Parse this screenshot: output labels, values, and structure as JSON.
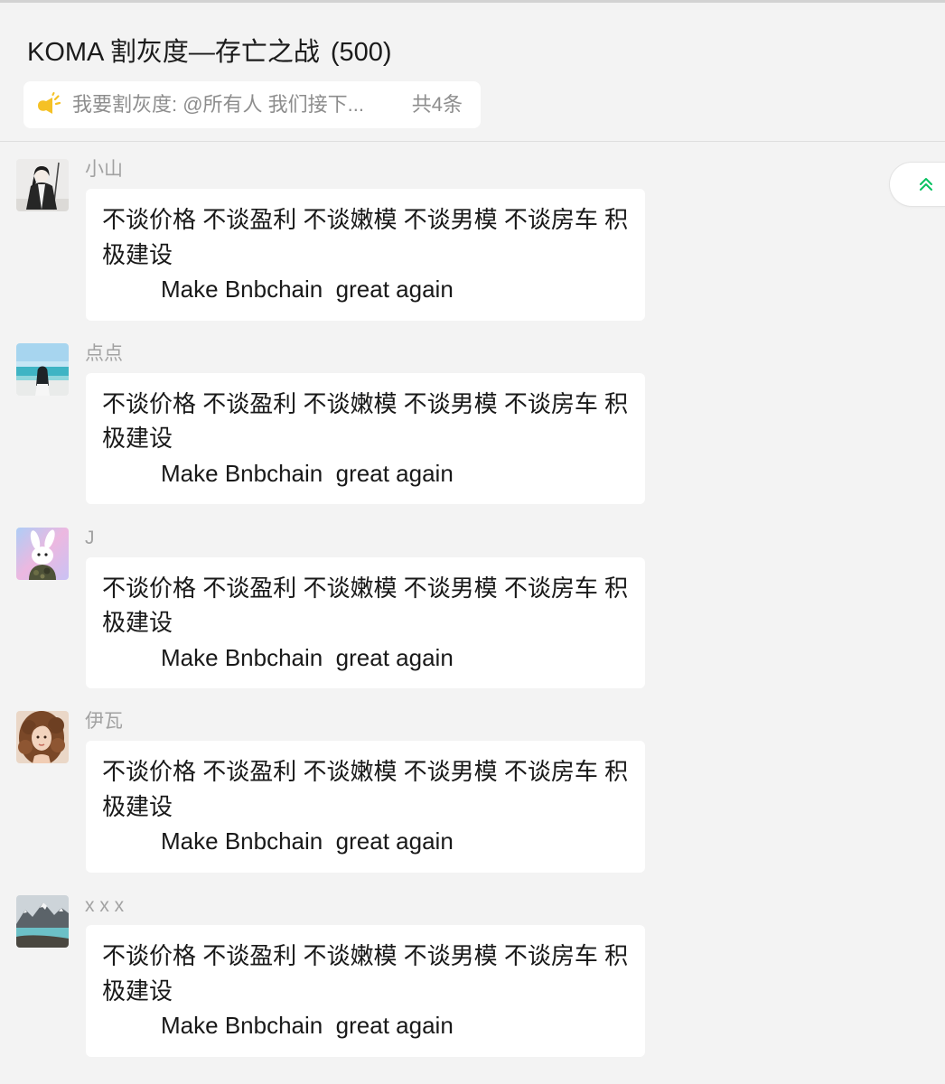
{
  "header": {
    "group_name": "KOMA 割灰度—存亡之战",
    "member_count": "(500)"
  },
  "pinned": {
    "icon": "megaphone-icon",
    "text": "我要割灰度: @所有人 我们接下...",
    "count": "共4条"
  },
  "scroll_to_top": {
    "icon": "double-chevron-up-icon"
  },
  "messages": [
    {
      "sender": "小山",
      "text": "不谈价格 不谈盈利 不谈嫩模 不谈男模 不谈房车 积极建设\n         Make Bnbchain  great again"
    },
    {
      "sender": "点点",
      "text": "不谈价格 不谈盈利 不谈嫩模 不谈男模 不谈房车 积极建设\n         Make Bnbchain  great again"
    },
    {
      "sender": "J",
      "text": "不谈价格 不谈盈利 不谈嫩模 不谈男模 不谈房车 积极建设\n         Make Bnbchain  great again"
    },
    {
      "sender": "伊瓦",
      "text": "不谈价格 不谈盈利 不谈嫩模 不谈男模 不谈房车 积极建设\n         Make Bnbchain  great again"
    },
    {
      "sender": "x x x",
      "text": "不谈价格 不谈盈利 不谈嫩模 不谈男模 不谈房车 积极建设\n         Make Bnbchain  great again"
    }
  ],
  "colors": {
    "background": "#f3f3f3",
    "bubble": "#ffffff",
    "accent": "#07c160",
    "pinned_icon": "#f5c125",
    "sender_name": "#a2a2a2"
  }
}
